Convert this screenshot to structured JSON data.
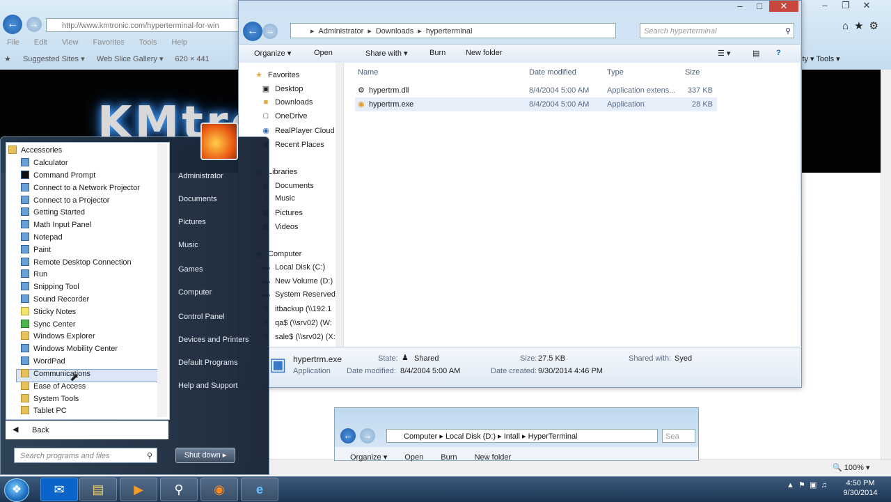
{
  "ie": {
    "address": "http://www.kmtronic.com/hyperterminal-for-win",
    "menu": [
      "File",
      "Edit",
      "View",
      "Favorites",
      "Tools",
      "Help"
    ],
    "favorites": [
      "Suggested Sites ▾",
      "Web Slice Gallery ▾",
      "620 × 441"
    ],
    "right_tools": "ity ▾   Tools ▾",
    "banner_brand": "KMtro",
    "zoom": "100%"
  },
  "explorer": {
    "breadcrumb": [
      "Administrator",
      "Downloads",
      "hyperterminal"
    ],
    "search_placeholder": "Search hyperterminal",
    "toolbar": {
      "organize": "Organize ▾",
      "open": "Open",
      "share_with": "Share with ▾",
      "burn": "Burn",
      "new_folder": "New folder"
    },
    "nav": {
      "favorites_header": "Favorites",
      "favorites": [
        "Desktop",
        "Downloads",
        "OneDrive",
        "RealPlayer Cloud",
        "Recent Places"
      ],
      "libraries_header": "Libraries",
      "libraries": [
        "Documents",
        "Music",
        "Pictures",
        "Videos"
      ],
      "computer_header": "Computer",
      "drives": [
        "Local Disk (C:)",
        "New Volume (D:)",
        "System Reserved",
        "itbackup (\\\\192.1",
        "qa$ (\\\\srv02) (W:",
        "sale$ (\\\\srv02) (X:"
      ]
    },
    "columns": {
      "name": "Name",
      "date": "Date modified",
      "type": "Type",
      "size": "Size"
    },
    "files": [
      {
        "name": "hypertrm.dll",
        "date": "8/4/2004 5:00 AM",
        "type": "Application extens...",
        "size": "337 KB"
      },
      {
        "name": "hypertrm.exe",
        "date": "8/4/2004 5:00 AM",
        "type": "Application",
        "size": "28 KB"
      }
    ],
    "details": {
      "name": "hypertrm.exe",
      "kind": "Application",
      "state_label": "State:",
      "state": "Shared",
      "size_label": "Size:",
      "size": "27.5 KB",
      "shared_label": "Shared with:",
      "shared": "Syed",
      "modified_label": "Date modified:",
      "modified": "8/4/2004 5:00 AM",
      "created_label": "Date created:",
      "created": "9/30/2014 4:46 PM"
    }
  },
  "explorer2": {
    "breadcrumb": [
      "Computer",
      "Local Disk (D:)",
      "Intall",
      "HyperTerminal"
    ],
    "search": "Sea",
    "toolbar": [
      "Organize ▾",
      "Open",
      "Burn",
      "New folder"
    ]
  },
  "start_menu": {
    "programs": [
      {
        "label": "Accessories",
        "kind": "folder"
      },
      {
        "label": "Calculator",
        "kind": "app"
      },
      {
        "label": "Command Prompt",
        "kind": "app"
      },
      {
        "label": "Connect to a Network Projector",
        "kind": "app"
      },
      {
        "label": "Connect to a Projector",
        "kind": "app"
      },
      {
        "label": "Getting Started",
        "kind": "app"
      },
      {
        "label": "Math Input Panel",
        "kind": "app"
      },
      {
        "label": "Notepad",
        "kind": "app"
      },
      {
        "label": "Paint",
        "kind": "app"
      },
      {
        "label": "Remote Desktop Connection",
        "kind": "app"
      },
      {
        "label": "Run",
        "kind": "app"
      },
      {
        "label": "Snipping Tool",
        "kind": "app"
      },
      {
        "label": "Sound Recorder",
        "kind": "app"
      },
      {
        "label": "Sticky Notes",
        "kind": "app"
      },
      {
        "label": "Sync Center",
        "kind": "app"
      },
      {
        "label": "Windows Explorer",
        "kind": "app"
      },
      {
        "label": "Windows Mobility Center",
        "kind": "app"
      },
      {
        "label": "WordPad",
        "kind": "app"
      },
      {
        "label": "Communications",
        "kind": "folder"
      },
      {
        "label": "Ease of Access",
        "kind": "folder"
      },
      {
        "label": "System Tools",
        "kind": "folder"
      },
      {
        "label": "Tablet PC",
        "kind": "folder"
      }
    ],
    "back": "Back",
    "search_placeholder": "Search programs and files",
    "right": [
      "Administrator",
      "Documents",
      "Pictures",
      "Music",
      "Games",
      "Computer",
      "Control Panel",
      "Devices and Printers",
      "Default Programs",
      "Help and Support"
    ],
    "shutdown": "Shut down ▸"
  },
  "taskbar": {
    "time": "4:50 PM",
    "date": "9/30/2014"
  }
}
